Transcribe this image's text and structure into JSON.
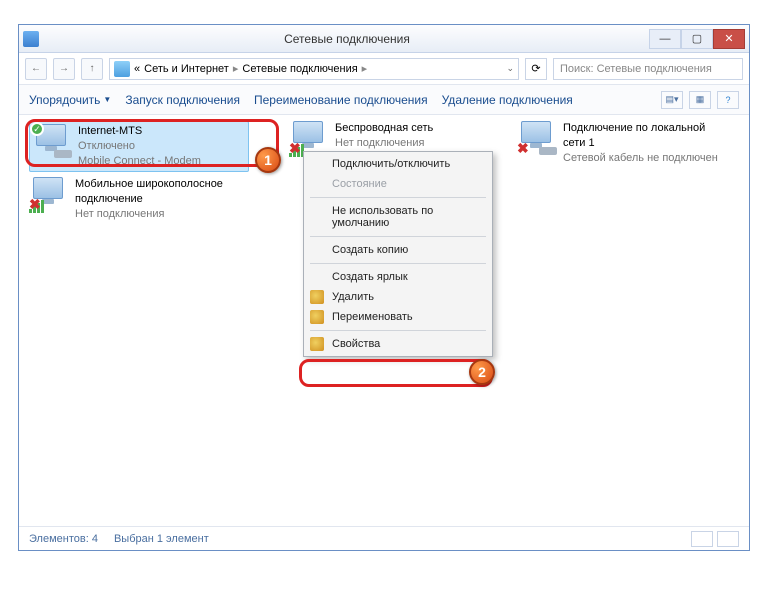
{
  "title": "Сетевые подключения",
  "breadcrumb": {
    "root": "Сеть и Интернет",
    "current": "Сетевые подключения"
  },
  "search_placeholder": "Поиск: Сетевые подключения",
  "toolbar": {
    "organize": "Упорядочить",
    "start": "Запуск подключения",
    "rename": "Переименование подключения",
    "delete": "Удаление подключения"
  },
  "connections": [
    {
      "name": "Internet-MTS",
      "status": "Отключено",
      "device": "Mobile Connect - Modem",
      "kind": "modem",
      "selected": true,
      "check": true
    },
    {
      "name": "Беспроводная сеть",
      "status": "Нет подключения",
      "device": "",
      "kind": "wifi",
      "err": true
    },
    {
      "name": "Подключение по локальной сети 1",
      "status": "Сетевой кабель не подключен",
      "device": "",
      "kind": "lan",
      "err": true
    },
    {
      "name": "Мобильное широкополосное подключение",
      "status": "Нет подключения",
      "device": "",
      "kind": "wifi",
      "err": true
    }
  ],
  "context_menu": [
    {
      "label": "Подключить/отключить",
      "type": "item"
    },
    {
      "label": "Состояние",
      "type": "item",
      "disabled": true
    },
    {
      "type": "sep"
    },
    {
      "label": "Не использовать по умолчанию",
      "type": "item"
    },
    {
      "type": "sep"
    },
    {
      "label": "Создать копию",
      "type": "item"
    },
    {
      "type": "sep"
    },
    {
      "label": "Создать ярлык",
      "type": "item"
    },
    {
      "label": "Удалить",
      "type": "item",
      "icon": "shield"
    },
    {
      "label": "Переименовать",
      "type": "item",
      "icon": "shield"
    },
    {
      "type": "sep"
    },
    {
      "label": "Свойства",
      "type": "item",
      "icon": "shield"
    }
  ],
  "status": {
    "count": "Элементов: 4",
    "selected": "Выбран 1 элемент"
  },
  "markers": {
    "1": "1",
    "2": "2"
  }
}
